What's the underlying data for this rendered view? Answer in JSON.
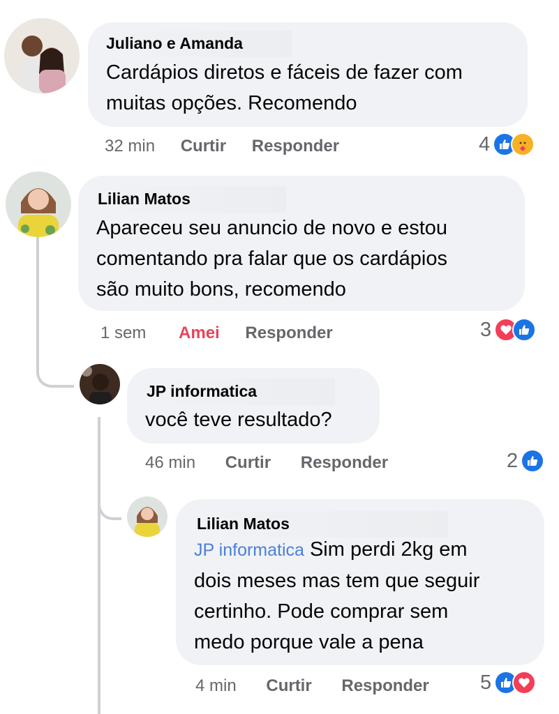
{
  "comments": [
    {
      "author": "Juliano e Amanda",
      "text_lines": [
        "Cardápios diretos e fáceis de fazer com",
        "muitas opções. Recomendo"
      ],
      "time": "32 min",
      "action": "Curtir",
      "reply": "Responder",
      "reaction_count": "4",
      "reactions": [
        "like-icon",
        "care-icon"
      ]
    },
    {
      "author": "Lilian Matos",
      "text_lines": [
        "Apareceu seu anuncio de novo e estou",
        "comentando pra falar que os cardápios",
        "são muito bons, recomendo"
      ],
      "time": "1 sem",
      "action": "Amei",
      "reply": "Responder",
      "reaction_count": "3",
      "reactions": [
        "heart-icon",
        "like-icon"
      ]
    },
    {
      "author": "JP informatica",
      "text_lines": [
        "você teve resultado?"
      ],
      "time": "46 min",
      "action": "Curtir",
      "reply": "Responder",
      "reaction_count": "2",
      "reactions": [
        "like-icon"
      ]
    },
    {
      "author": "Lilian Matos",
      "mention": "JP informatica",
      "text_lines": [
        "Sim perdi 2kg em",
        "dois meses mas tem que seguir",
        "certinho. Pode comprar sem",
        "medo porque vale a pena"
      ],
      "time": "4 min",
      "action": "Curtir",
      "reply": "Responder",
      "reaction_count": "5",
      "reactions": [
        "like-icon",
        "heart-icon"
      ]
    }
  ],
  "colors": {
    "bubble": "#f0f2f5",
    "like": "#1b74e4",
    "love": "#f33e58",
    "meta": "#65676b",
    "mention": "#4b7fdb"
  }
}
